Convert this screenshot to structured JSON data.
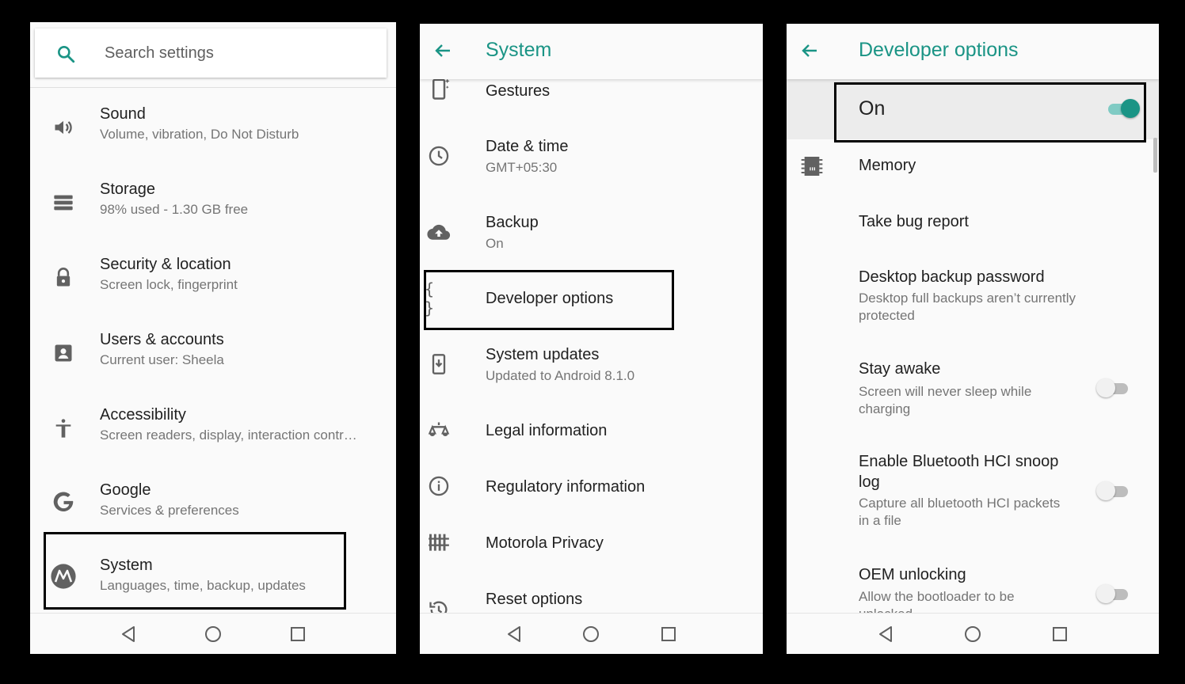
{
  "settings": {
    "search": {
      "placeholder": "Search settings",
      "icon": "search-icon"
    },
    "items": [
      {
        "title": "Sound",
        "subtitle": "Volume, vibration, Do Not Disturb",
        "icon": "volume-icon"
      },
      {
        "title": "Storage",
        "subtitle": "98% used - 1.30 GB free",
        "icon": "storage-icon"
      },
      {
        "title": "Security & location",
        "subtitle": "Screen lock, fingerprint",
        "icon": "lock-icon"
      },
      {
        "title": "Users & accounts",
        "subtitle": "Current user: Sheela",
        "icon": "account-icon"
      },
      {
        "title": "Accessibility",
        "subtitle": "Screen readers, display, interaction contr…",
        "icon": "accessibility-icon"
      },
      {
        "title": "Google",
        "subtitle": "Services & preferences",
        "icon": "google-icon"
      },
      {
        "title": "System",
        "subtitle": "Languages, time, backup, updates",
        "icon": "motorola-icon"
      }
    ]
  },
  "system": {
    "title": "System",
    "items": [
      {
        "title": "Gestures",
        "subtitle": "",
        "icon": "gestures-icon"
      },
      {
        "title": "Date & time",
        "subtitle": "GMT+05:30",
        "icon": "clock-icon"
      },
      {
        "title": "Backup",
        "subtitle": "On",
        "icon": "cloud-upload-icon"
      },
      {
        "title": "Developer options",
        "subtitle": "",
        "icon": "code-braces-icon"
      },
      {
        "title": "System updates",
        "subtitle": "Updated to Android 8.1.0",
        "icon": "system-update-icon"
      },
      {
        "title": "Legal information",
        "subtitle": "",
        "icon": "scale-icon"
      },
      {
        "title": "Regulatory information",
        "subtitle": "",
        "icon": "info-icon"
      },
      {
        "title": "Motorola Privacy",
        "subtitle": "",
        "icon": "fence-icon"
      },
      {
        "title": "Reset options",
        "subtitle": "",
        "icon": "restore-icon"
      }
    ]
  },
  "developer": {
    "title": "Developer options",
    "master": {
      "label": "On",
      "enabled": true
    },
    "items": [
      {
        "title": "Memory",
        "subtitle": "",
        "icon": "memory-icon"
      },
      {
        "title": "Take bug report",
        "subtitle": ""
      },
      {
        "title": "Desktop backup password",
        "subtitle_lines": [
          "Desktop full backups aren’t currently",
          "protected"
        ]
      },
      {
        "title_lines": [
          "Stay awake"
        ],
        "subtitle_lines": [
          "Screen will never sleep while",
          "charging"
        ],
        "enabled": false
      },
      {
        "title_lines": [
          "Enable Bluetooth HCI snoop",
          "log"
        ],
        "subtitle_lines": [
          "Capture all bluetooth HCI packets",
          "in a file"
        ],
        "enabled": false
      },
      {
        "title_lines": [
          "OEM unlocking"
        ],
        "subtitle_lines": [
          "Allow the bootloader to be",
          "unlocked"
        ],
        "enabled": false
      }
    ]
  },
  "nav": {
    "back": "back-icon",
    "home": "home-icon",
    "recents": "recents-icon"
  },
  "colors": {
    "accent": "#1a9485",
    "highlight_border": "#000000",
    "background": "#fafafa"
  }
}
